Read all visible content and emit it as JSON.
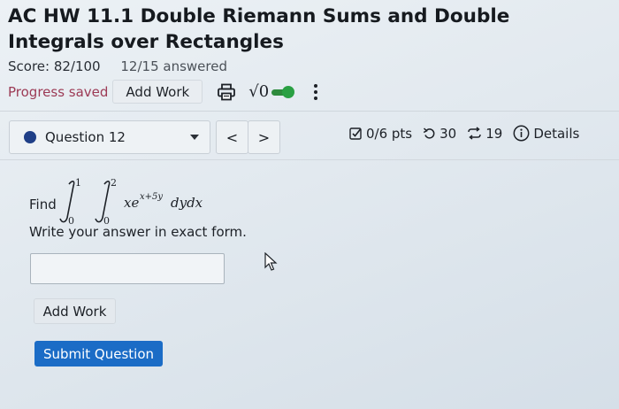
{
  "assignment": {
    "title": "AC HW 11.1 Double Riemann Sums and Double Integrals over Rectangles",
    "score": "Score: 82/100",
    "answered": "12/15 answered"
  },
  "toolbar": {
    "progress_saved": "Progress saved",
    "add_work": "Add Work",
    "print_icon": "printer-icon",
    "sqrt_label": "√0",
    "toggle_icon": "toggle-on-icon",
    "menu_icon": "kebab-menu-icon"
  },
  "question_nav": {
    "selected": "Question 12",
    "prev": "<",
    "next": ">",
    "points": "0/6 pts",
    "retries": "30",
    "attempts": "19",
    "details": "Details"
  },
  "problem": {
    "find": "Find",
    "outer_upper": "1",
    "outer_lower": "0",
    "inner_upper": "2",
    "inner_lower": "0",
    "integrand": "xe",
    "exponent": "x+5y",
    "differentials": "dydx",
    "instruction": "Write your answer in exact form."
  },
  "answer": {
    "value": "",
    "placeholder": ""
  },
  "actions": {
    "add_work": "Add Work",
    "submit": "Submit Question"
  },
  "colors": {
    "accent": "#1b6cc6",
    "progress_saved": "#9c3a55",
    "toggle": "#2aa043",
    "question_dot": "#1f3f87"
  }
}
